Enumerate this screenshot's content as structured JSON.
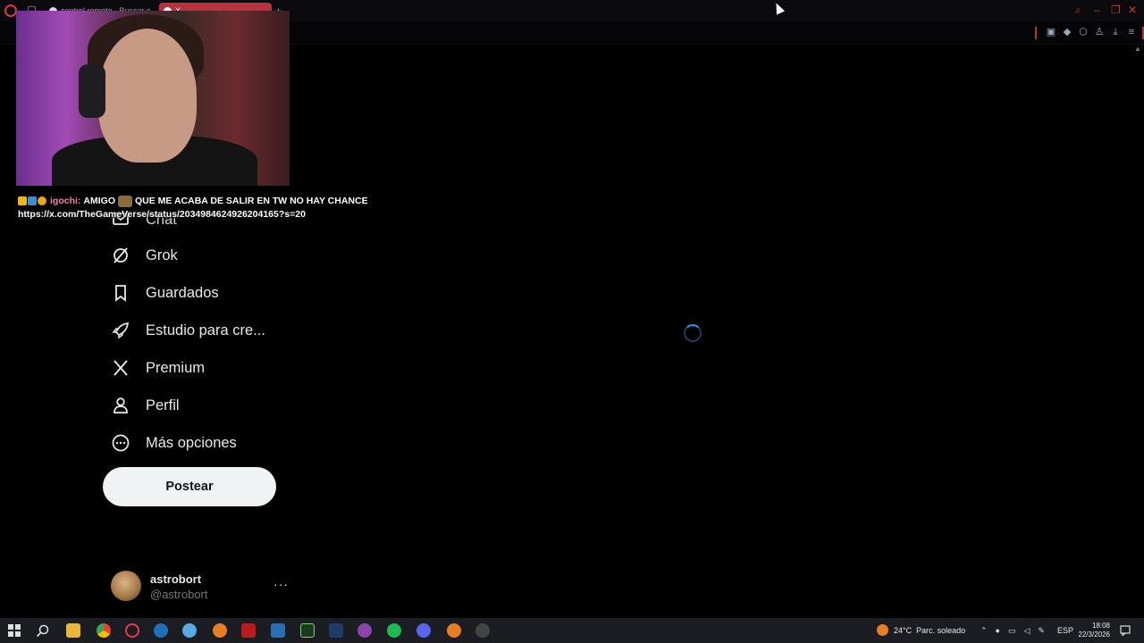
{
  "browser": {
    "tabs": [
      {
        "title": "control remoto - Buscar c"
      },
      {
        "title": "X"
      }
    ],
    "new_tab_symbol": "+",
    "accent_color": "#b8323f"
  },
  "chat_overlay": {
    "username": "igochi:",
    "message": "AMIGO",
    "message_rest": "QUE ME ACABA DE SALIR EN TW NO HAY CHANCE",
    "link": "https://x.com/TheGameVerse/status/2034984624926204165?s=20"
  },
  "nav": {
    "items": [
      {
        "label": "Chat",
        "icon": "mail-icon"
      },
      {
        "label": "Grok",
        "icon": "grok-icon"
      },
      {
        "label": "Guardados",
        "icon": "bookmark-icon"
      },
      {
        "label": "Estudio para cre...",
        "icon": "rocket-icon"
      },
      {
        "label": "Premium",
        "icon": "x-logo-icon"
      },
      {
        "label": "Perfil",
        "icon": "person-icon"
      },
      {
        "label": "Más opciones",
        "icon": "more-circle-icon"
      }
    ],
    "post_button": "Postear"
  },
  "account": {
    "name": "astrobort",
    "handle": "@astrobort",
    "more": "···"
  },
  "taskbar": {
    "weather_temp": "24°C",
    "weather_text": "Parc. soleado",
    "language": "ESP",
    "time": "18:08",
    "date": "22/3/2026"
  }
}
